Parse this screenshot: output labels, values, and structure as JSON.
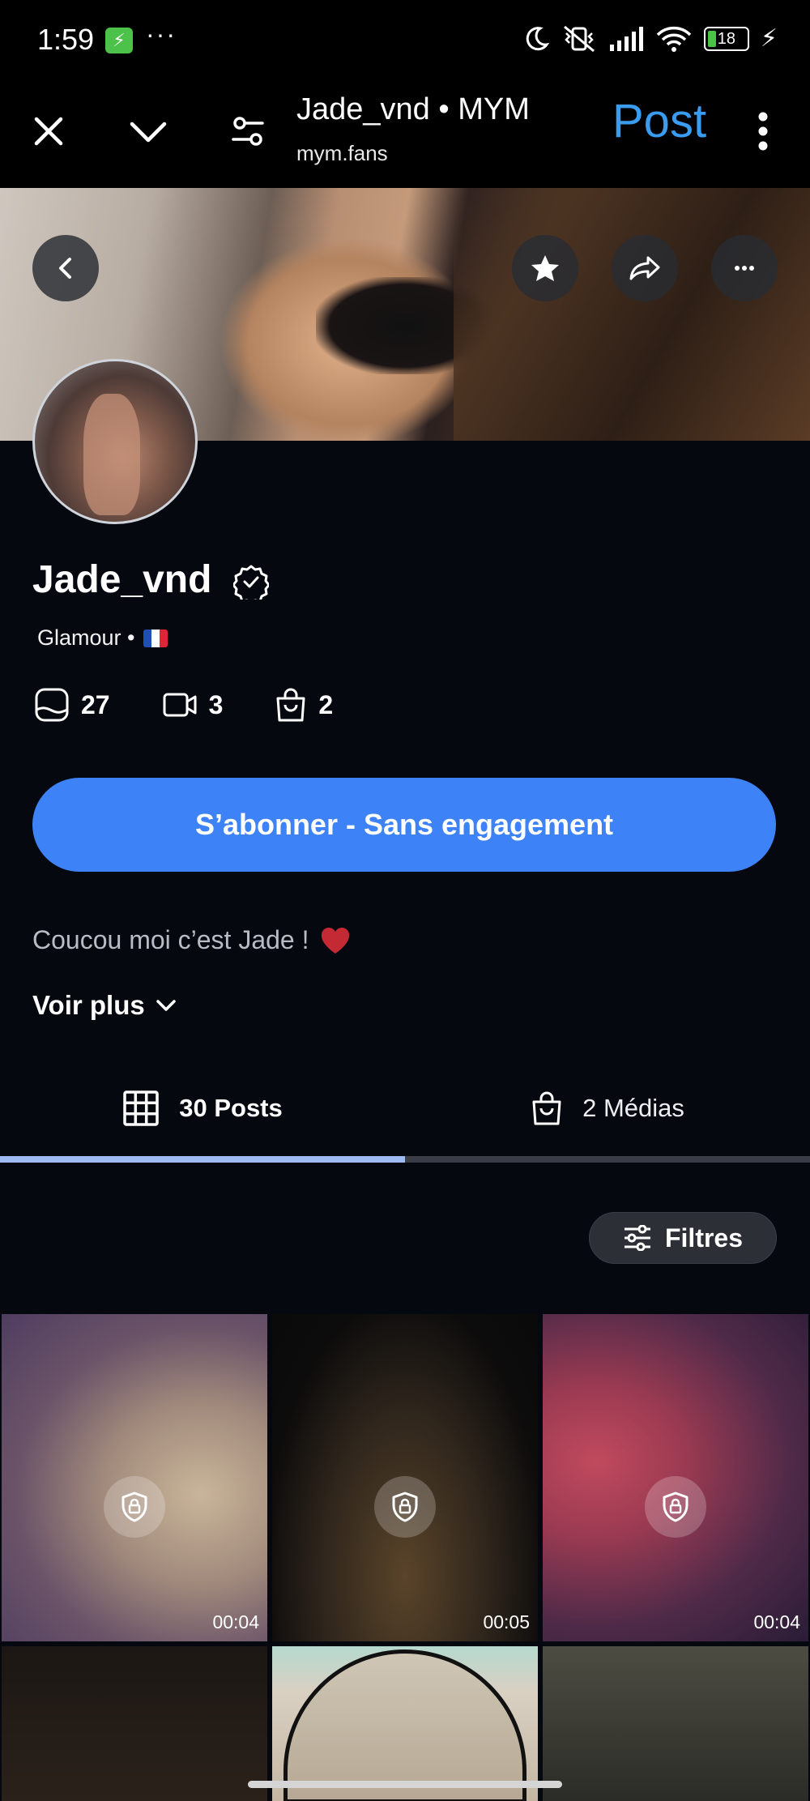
{
  "status_bar": {
    "time": "1:59",
    "overflow": "···",
    "battery": "18",
    "icons": [
      "moon-icon",
      "vibrate-off-icon",
      "signal-icon",
      "wifi-icon",
      "battery-icon",
      "charging-icon"
    ]
  },
  "browser": {
    "title": "Jade_vnd • MYM",
    "url": "mym.fans",
    "post_label": "Post",
    "icons": [
      "close-icon",
      "chevron-down-icon",
      "site-settings-icon",
      "kebab-menu-icon"
    ]
  },
  "cover": {
    "buttons": [
      "back-icon",
      "star-icon",
      "share-icon",
      "more-icon"
    ]
  },
  "profile": {
    "name": "Jade_vnd",
    "category": "Glamour •",
    "flag_colors": [
      "#1f4fb2",
      "#ffffff",
      "#e0243a"
    ],
    "stats": [
      {
        "icon": "photo-icon",
        "value": "27"
      },
      {
        "icon": "video-icon",
        "value": "3"
      },
      {
        "icon": "shopping-bag-icon",
        "value": "2"
      }
    ],
    "subscribe_label": "S’abonner - Sans engagement",
    "bio": "Coucou moi c’est Jade !",
    "see_more": "Voir plus"
  },
  "tabs": [
    {
      "label": "30 Posts",
      "icon": "grid-icon",
      "active": true
    },
    {
      "label": "2 Médias",
      "icon": "shopping-bag-icon",
      "active": false
    }
  ],
  "filters_label": "Filtres",
  "grid_items": [
    {
      "duration": "00:04",
      "locked": true
    },
    {
      "duration": "00:05",
      "locked": true
    },
    {
      "duration": "00:04",
      "locked": true
    },
    {
      "duration": "",
      "locked": false
    },
    {
      "duration": "",
      "locked": false
    },
    {
      "duration": "",
      "locked": false
    }
  ],
  "colors": {
    "accent": "#3d82f7",
    "post_link": "#3a9cf1",
    "background": "#060810"
  }
}
